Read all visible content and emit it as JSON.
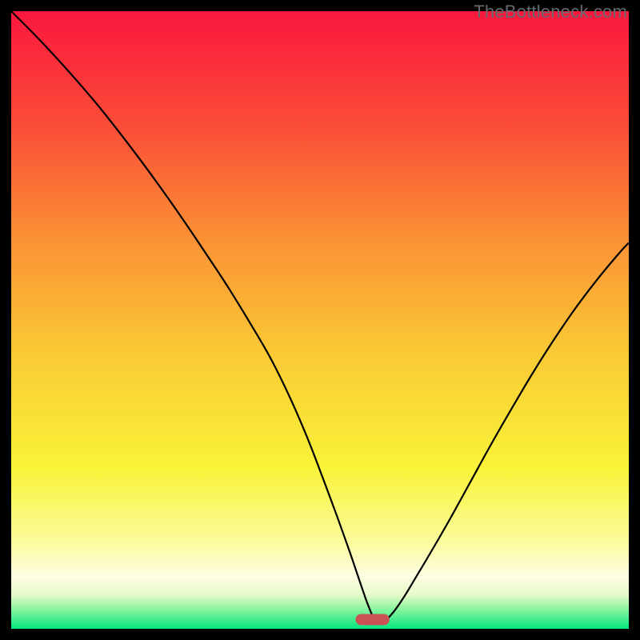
{
  "watermark": "TheBottleneck.com",
  "chart_data": {
    "type": "line",
    "title": "",
    "xlabel": "",
    "ylabel": "",
    "xlim": [
      0,
      1
    ],
    "ylim": [
      0,
      1
    ],
    "grid": false,
    "legend": false,
    "background_gradient_stops": [
      {
        "offset": 0.0,
        "color": "#f9173d"
      },
      {
        "offset": 0.18,
        "color": "#fb4b38"
      },
      {
        "offset": 0.36,
        "color": "#fb8e35"
      },
      {
        "offset": 0.55,
        "color": "#fac935"
      },
      {
        "offset": 0.74,
        "color": "#f9f338"
      },
      {
        "offset": 0.86,
        "color": "#fbfc9e"
      },
      {
        "offset": 0.915,
        "color": "#fefde3"
      },
      {
        "offset": 0.945,
        "color": "#e6fbc9"
      },
      {
        "offset": 0.965,
        "color": "#97f6a4"
      },
      {
        "offset": 1.0,
        "color": "#05e680"
      }
    ],
    "marker": {
      "x": 0.585,
      "y": 0.015,
      "color": "#ca5254",
      "width_frac": 0.055,
      "height_frac": 0.018
    },
    "series": [
      {
        "name": "bottleneck-curve",
        "x": [
          0.0,
          0.035,
          0.07,
          0.105,
          0.14,
          0.175,
          0.21,
          0.245,
          0.28,
          0.315,
          0.35,
          0.385,
          0.42,
          0.452,
          0.48,
          0.505,
          0.528,
          0.548,
          0.565,
          0.578,
          0.59,
          0.603,
          0.618,
          0.635,
          0.655,
          0.68,
          0.71,
          0.742,
          0.775,
          0.81,
          0.845,
          0.88,
          0.915,
          0.95,
          0.985,
          1.0
        ],
        "y": [
          1.0,
          0.965,
          0.928,
          0.889,
          0.848,
          0.804,
          0.758,
          0.71,
          0.66,
          0.608,
          0.555,
          0.498,
          0.438,
          0.373,
          0.308,
          0.243,
          0.181,
          0.125,
          0.075,
          0.038,
          0.013,
          0.012,
          0.026,
          0.05,
          0.083,
          0.125,
          0.177,
          0.235,
          0.295,
          0.356,
          0.415,
          0.47,
          0.521,
          0.567,
          0.609,
          0.625
        ]
      }
    ]
  }
}
